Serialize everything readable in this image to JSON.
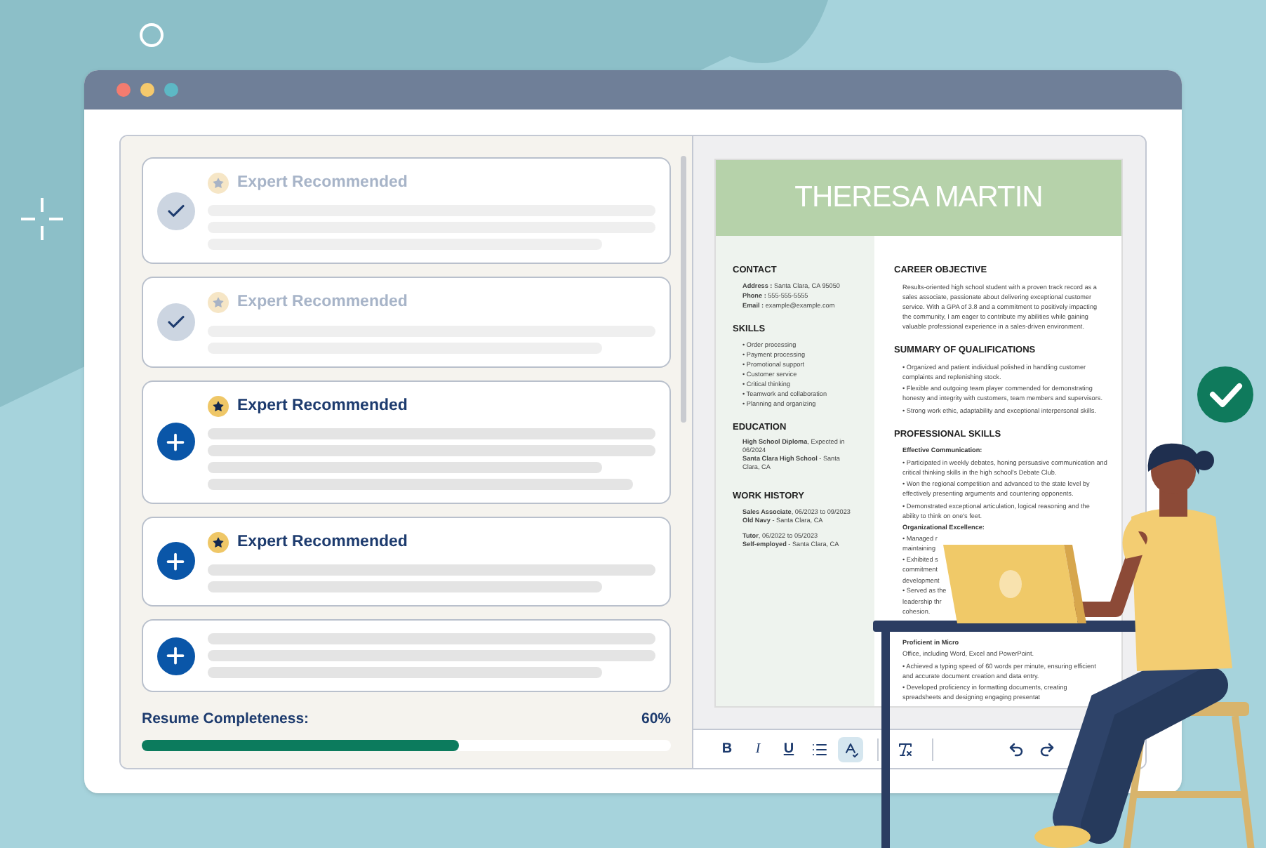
{
  "window": {
    "controls": [
      {
        "color": "#f47c6f"
      },
      {
        "color": "#f5c96c"
      },
      {
        "color": "#5db8c5"
      }
    ]
  },
  "suggestions": [
    {
      "completed": true,
      "badge": "Expert Recommended"
    },
    {
      "completed": true,
      "badge": "Expert Recommended"
    },
    {
      "completed": false,
      "badge": "Expert Recommended"
    },
    {
      "completed": false,
      "badge": "Expert Recommended"
    },
    {
      "completed": false
    }
  ],
  "completeness": {
    "label": "Resume Completeness:",
    "value": "60%",
    "level": 0.6
  },
  "resume": {
    "name": "THERESA MARTIN",
    "left_sections": [
      {
        "title": "CONTACT",
        "kind": "lines",
        "lines": [
          "**Address :** Santa Clara, CA 95050",
          "**Phone :** 555-555-5555",
          "**Email :** example@example.com"
        ]
      },
      {
        "title": "SKILLS",
        "kind": "bullets",
        "items": [
          "• Order processing",
          "• Payment processing",
          "• Promotional support",
          "• Customer service",
          "• Critical thinking",
          "• Teamwork and collaboration",
          "• Planning and organizing"
        ]
      },
      {
        "title": "EDUCATION",
        "kind": "entries",
        "entries": [
          [
            "**High School Diploma**, Expected in 06/2024",
            "**Santa Clara High School** - Santa Clara, CA"
          ]
        ]
      },
      {
        "title": "WORK HISTORY",
        "kind": "entries",
        "entries": [
          [
            "**Sales Associate**, 06/2023 to 09/2023",
            "**Old Navy** - Santa Clara, CA"
          ],
          [
            "**Tutor**, 06/2022 to 05/2023",
            "**Self-employed** - Santa Clara, CA"
          ]
        ]
      }
    ],
    "right_sections": [
      {
        "title": "CAREER OBJECTIVE",
        "kind": "paragraph",
        "text": "Results-oriented high school student with a proven track record as a sales associate, passionate about delivering exceptional customer service. With a GPA of 3.8 and a commitment to positively impacting the community, I am eager to contribute my abilities while gaining valuable professional experience in a sales-driven environment."
      },
      {
        "title": "SUMMARY OF QUALIFICATIONS",
        "kind": "bullets",
        "items": [
          {
            "kind": "bullet",
            "text": "• Organized and patient individual polished in handling customer complaints and replenishing stock."
          },
          {
            "kind": "bullet",
            "text": "• Flexible and outgoing team player commended for demonstrating honesty and integrity with customers, team members and supervisors."
          },
          {
            "kind": "bullet",
            "text": "• Strong work ethic, adaptability and exceptional interpersonal skills."
          }
        ]
      },
      {
        "title": "PROFESSIONAL SKILLS",
        "kind": "bullets",
        "items": [
          {
            "kind": "subheading",
            "text": "Effective Communication:"
          },
          {
            "kind": "bullet",
            "text": "• Participated in weekly debates, honing persuasive communication and critical thinking skills in the high school's Debate Club."
          },
          {
            "kind": "bullet",
            "text": "• Won the regional competition and advanced to the state level by effectively presenting arguments and countering opponents."
          },
          {
            "kind": "bullet",
            "text": "• Demonstrated exceptional articulation, logical reasoning and the ability to think on one's feet."
          },
          {
            "kind": "subheading",
            "text": "Organizational Excellence:"
          },
          {
            "kind": "fragment",
            "text": "• Managed r"
          },
          {
            "kind": "fragment",
            "text": "maintaining"
          },
          {
            "kind": "fragment",
            "text": "• Exhibited s"
          },
          {
            "kind": "fragment",
            "text": "commitment"
          },
          {
            "kind": "fragment",
            "text": "development"
          },
          {
            "kind": "fragment",
            "text": "• Served as the"
          },
          {
            "kind": "fragment",
            "text": "leadership thr"
          },
          {
            "kind": "fragment",
            "text": "cohesion."
          },
          {
            "kind": "subheading",
            "text": "Proficient in Micro"
          },
          {
            "kind": "bullet",
            "text": "Office, including Word, Excel and PowerPoint."
          },
          {
            "kind": "bullet",
            "text": "• Achieved a typing speed of 60 words per minute, ensuring efficient and accurate document creation and data entry."
          },
          {
            "kind": "bullet",
            "text": "• Developed proficiency in formatting documents, creating spreadsheets and designing engaging presentat"
          }
        ]
      }
    ]
  },
  "toolbar": [
    {
      "kind": "bold",
      "label": "B",
      "selected": false
    },
    {
      "kind": "italic",
      "label": "I",
      "selected": false
    },
    {
      "kind": "underline",
      "label": "U",
      "selected": false
    },
    {
      "kind": "list",
      "selected": false
    },
    {
      "kind": "spellcheck",
      "selected": true
    },
    {
      "kind": "divider"
    },
    {
      "kind": "clear-format",
      "selected": false
    },
    {
      "kind": "divider"
    },
    {
      "kind": "undo",
      "selected": false
    },
    {
      "kind": "redo",
      "selected": false
    }
  ]
}
